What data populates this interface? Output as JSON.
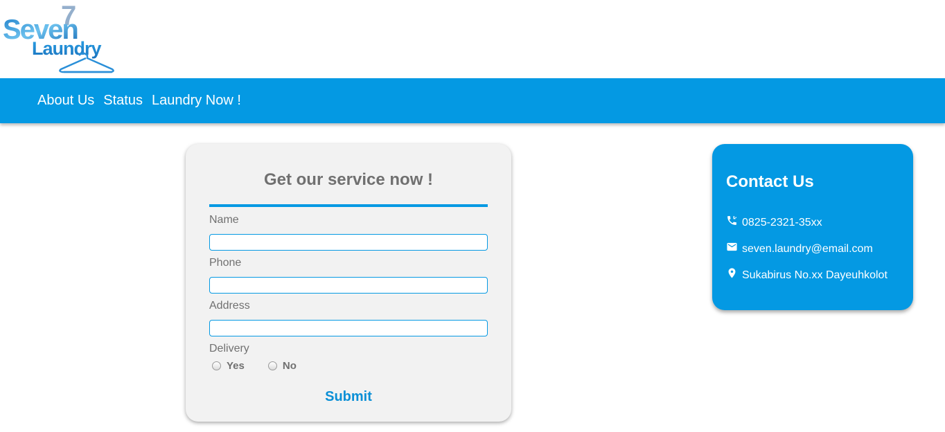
{
  "logo": {
    "line1": "Seven",
    "line2": "Laundry",
    "numeral": "7"
  },
  "nav": {
    "items": [
      {
        "label": "About Us"
      },
      {
        "label": "Status"
      },
      {
        "label": "Laundry Now !"
      }
    ]
  },
  "form": {
    "title": "Get our service now !",
    "fields": {
      "name": {
        "label": "Name",
        "value": ""
      },
      "phone": {
        "label": "Phone",
        "value": ""
      },
      "address": {
        "label": "Address",
        "value": ""
      }
    },
    "delivery": {
      "label": "Delivery",
      "options": [
        {
          "label": "Yes"
        },
        {
          "label": "No"
        }
      ]
    },
    "submit_label": "Submit"
  },
  "contact": {
    "title": "Contact Us",
    "phone": "0825-2321-35xx",
    "email": "seven.laundry@email.com",
    "address": "Sukabirus No.xx Dayeuhkolot"
  },
  "colors": {
    "brand_blue": "#0499e3",
    "card_gray": "#f2f2f2",
    "text_gray": "#707070"
  }
}
